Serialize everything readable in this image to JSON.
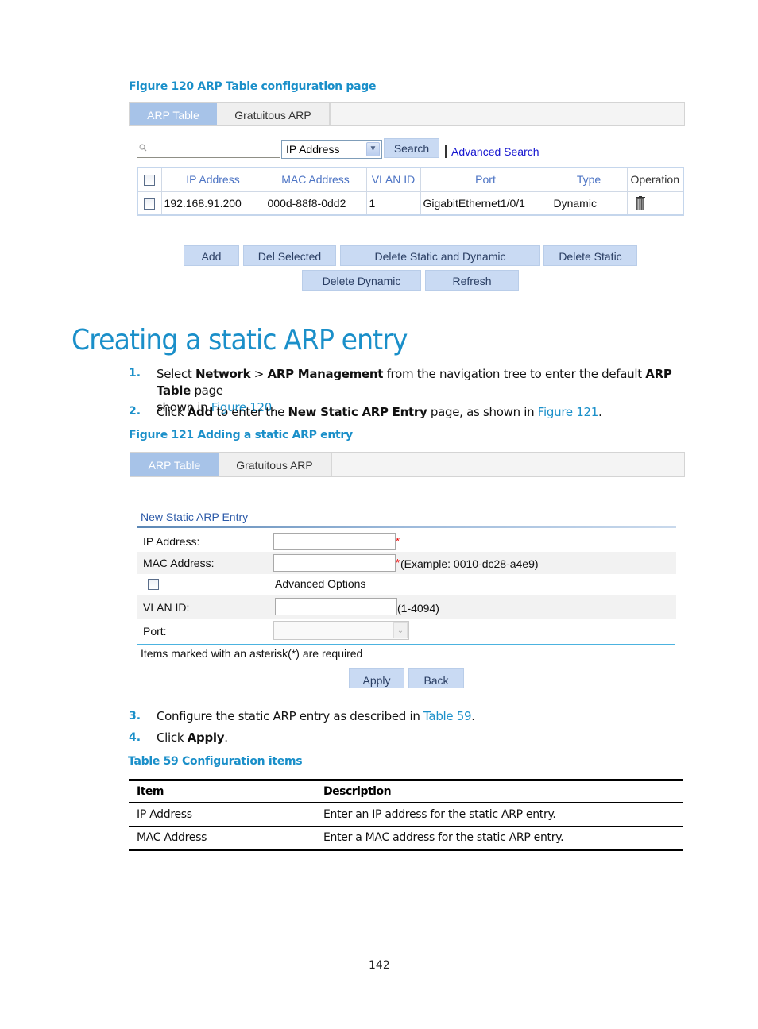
{
  "figure120": {
    "caption": "Figure 120 ARP Table configuration page",
    "tabs": [
      {
        "label": "ARP Table",
        "active": true
      },
      {
        "label": "Gratuitous ARP",
        "active": false
      }
    ],
    "search": {
      "input_value": "",
      "field_select": "IP Address",
      "search_button": "Search",
      "advanced_link": "Advanced Search"
    },
    "table": {
      "headers": [
        "IP Address",
        "MAC Address",
        "VLAN ID",
        "Port",
        "Type",
        "Operation"
      ],
      "rows": [
        {
          "ip": "192.168.91.200",
          "mac": "000d-88f8-0dd2",
          "vlan": "1",
          "port": "GigabitEthernet1/0/1",
          "type": "Dynamic",
          "operation_icon": "trash-icon"
        }
      ]
    },
    "buttons_row1": [
      "Add",
      "Del Selected",
      "Delete Static and Dynamic",
      "Delete Static"
    ],
    "buttons_row2": [
      "Delete Dynamic",
      "Refresh"
    ]
  },
  "section": {
    "heading": "Creating a static ARP entry",
    "steps": [
      {
        "num": "1.",
        "parts": {
          "a": "Select ",
          "b1": "Network",
          "c": " > ",
          "b2": "ARP Management",
          "d": " from the navigation tree to enter the default ",
          "b3": "ARP Table",
          "e": " page",
          "line2": "shown in ",
          "link": "Figure 120",
          "end": "."
        }
      },
      {
        "num": "2.",
        "parts": {
          "a": "Click ",
          "b1": "Add",
          "c": " to enter the ",
          "b2": "New Static ARP Entry",
          "d": " page, as shown in ",
          "link": "Figure 121",
          "end": "."
        }
      },
      {
        "num": "3.",
        "parts": {
          "a": "Configure the static ARP entry as described in ",
          "link": "Table 59",
          "end": "."
        }
      },
      {
        "num": "4.",
        "parts": {
          "a": "Click ",
          "b1": "Apply",
          "end": "."
        }
      }
    ]
  },
  "figure121": {
    "caption": "Figure 121 Adding a static ARP entry",
    "tabs": [
      {
        "label": "ARP Table",
        "active": true
      },
      {
        "label": "Gratuitous ARP",
        "active": false
      }
    ],
    "form": {
      "title": "New Static ARP Entry",
      "ip_label": "IP Address:",
      "ip_value": "",
      "mac_label": "MAC Address:",
      "mac_value": "",
      "required_mark": "*",
      "mac_hint": "(Example: 0010-dc28-a4e9)",
      "advanced_label": "Advanced Options",
      "advanced_checked": false,
      "vlan_label": "VLAN ID:",
      "vlan_value": "",
      "vlan_hint": "(1-4094)",
      "port_label": "Port:",
      "port_value": "",
      "note": "Items marked with an asterisk(*) are required",
      "apply_button": "Apply",
      "back_button": "Back"
    }
  },
  "table59": {
    "caption": "Table 59 Configuration items",
    "headers": [
      "Item",
      "Description"
    ],
    "rows": [
      [
        "IP Address",
        "Enter an IP address for the static ARP entry."
      ],
      [
        "MAC Address",
        "Enter a MAC address for the static ARP entry."
      ]
    ]
  },
  "page_number": "142"
}
